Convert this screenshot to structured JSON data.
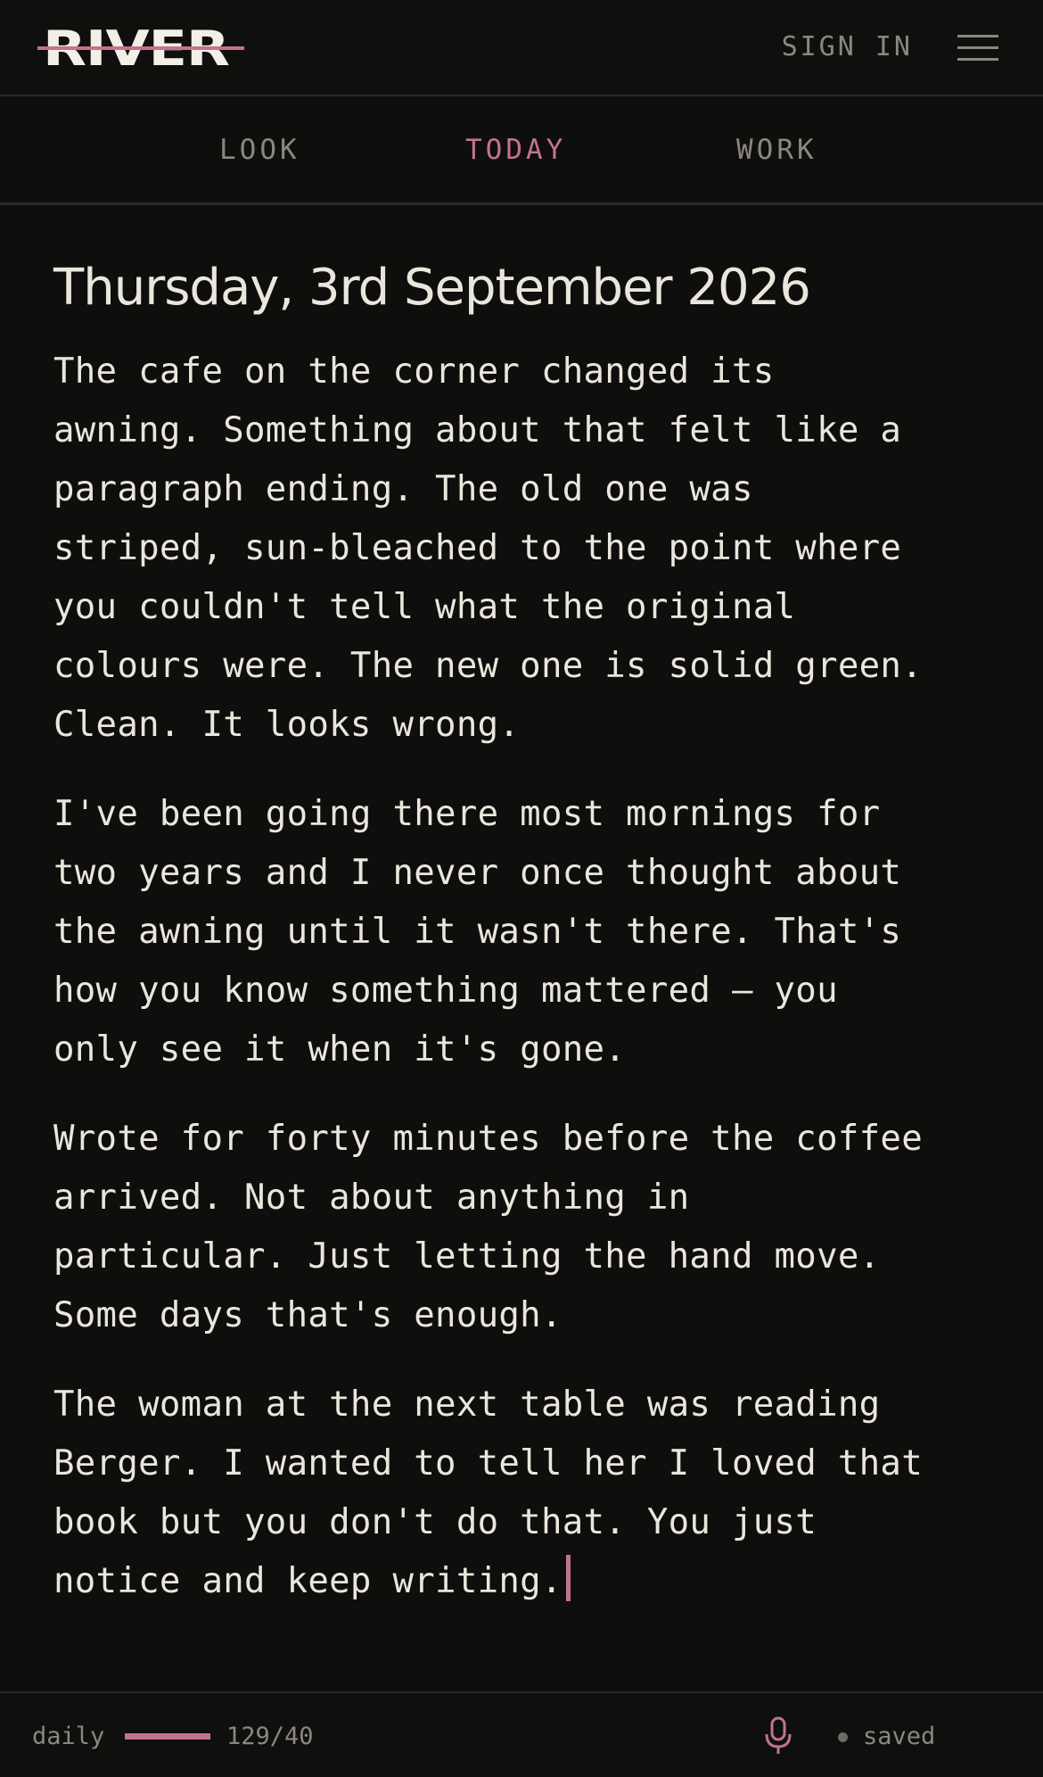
{
  "header": {
    "logo_text": "RIVER",
    "signin_label": "SIGN IN",
    "menu_icon": "hamburger-menu-icon"
  },
  "tabs": [
    {
      "label": "LOOK",
      "active": false
    },
    {
      "label": "TODAY",
      "active": true
    },
    {
      "label": "WORK",
      "active": false
    }
  ],
  "entry": {
    "date": "Thursday, 3rd September 2026",
    "paragraphs": [
      "The cafe on the corner changed its\nawning. Something about that felt like a\nparagraph ending. The old one was\nstriped, sun-bleached to the point where\nyou couldn't tell what the original\ncolours were. The new one is solid green.\nClean. It looks wrong.",
      "I've been going there most mornings for\ntwo years and I never once thought about\nthe awning until it wasn't there. That's\nhow you know something mattered — you\nonly see it when it's gone.",
      "Wrote for forty minutes before the coffee\narrived. Not about anything in\nparticular. Just letting the hand move.\nSome days that's enough.",
      "The woman at the next table was reading\nBerger. I wanted to tell her I loved that\nbook but you don't do that. You just\nnotice and keep writing."
    ]
  },
  "footer": {
    "mode_label": "daily",
    "word_count": "129/40",
    "progress_fraction": 1.0,
    "mic_icon": "microphone-icon",
    "status_text": "saved"
  },
  "colors": {
    "accent": "#c2738d",
    "background": "#0e0e0d",
    "text": "#ebe6dc",
    "muted": "#8b877f",
    "divider": "#2b2a28"
  }
}
